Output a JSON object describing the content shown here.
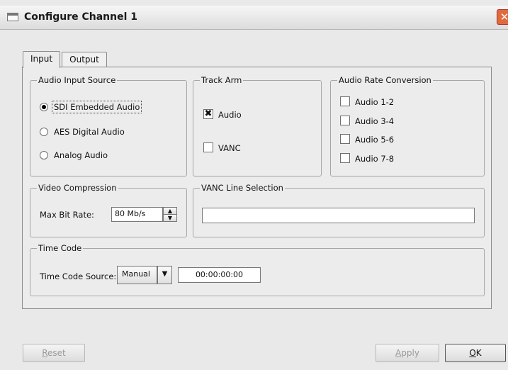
{
  "window": {
    "title": "Configure Channel 1",
    "close_glyph": "✕"
  },
  "tabs": [
    {
      "label": "Input",
      "active": true
    },
    {
      "label": "Output",
      "active": false
    }
  ],
  "audio_input_source": {
    "legend": "Audio Input Source",
    "options": [
      {
        "label": "SDI Embedded Audio",
        "selected": true
      },
      {
        "label": "AES Digital Audio",
        "selected": false
      },
      {
        "label": "Analog Audio",
        "selected": false
      }
    ]
  },
  "track_arm": {
    "legend": "Track Arm",
    "items": [
      {
        "label": "Audio",
        "checked": true,
        "mark": "✖"
      },
      {
        "label": "VANC",
        "checked": false,
        "mark": ""
      }
    ]
  },
  "audio_rate_conversion": {
    "legend": "Audio Rate Conversion",
    "items": [
      {
        "label": "Audio 1-2",
        "checked": false
      },
      {
        "label": "Audio 3-4",
        "checked": false
      },
      {
        "label": "Audio 5-6",
        "checked": false
      },
      {
        "label": "Audio 7-8",
        "checked": false
      }
    ]
  },
  "video_compression": {
    "legend": "Video Compression",
    "max_bit_rate_label": "Max Bit Rate:",
    "max_bit_rate_value": "80 Mb/s",
    "up_glyph": "▲",
    "down_glyph": "▼"
  },
  "vanc_line_selection": {
    "legend": "VANC Line Selection",
    "value": ""
  },
  "time_code": {
    "legend": "Time Code",
    "source_label": "Time Code Source:",
    "source_value": "Manual",
    "dropdown_glyph": "▼",
    "timecode_value": "00:00:00:00"
  },
  "buttons": {
    "reset": {
      "first": "R",
      "rest": "eset"
    },
    "apply": {
      "first": "A",
      "rest": "pply"
    },
    "ok": {
      "first": "O",
      "rest": "K"
    }
  }
}
